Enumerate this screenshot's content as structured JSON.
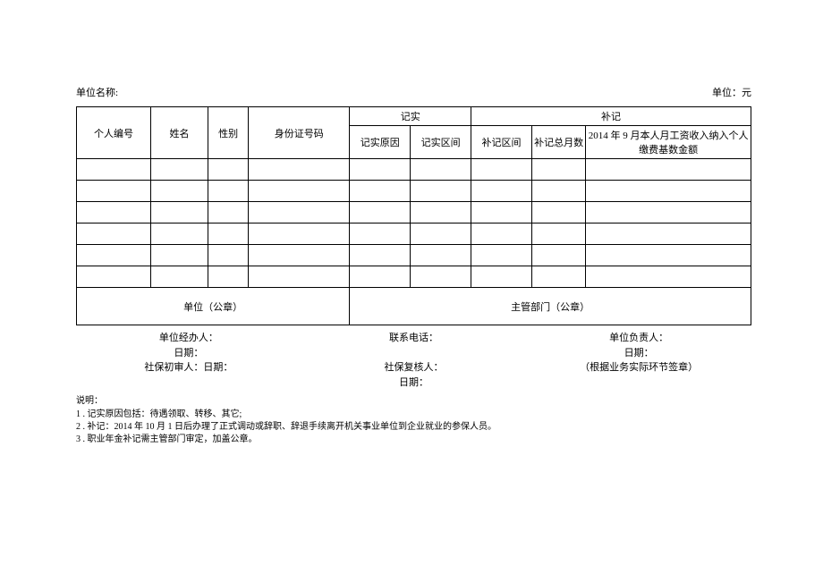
{
  "header": {
    "org_label": "单位名称:",
    "unit_label": "单位：元"
  },
  "table": {
    "cols": {
      "id": "个人编号",
      "name": "姓名",
      "gender": "性别",
      "idnum": "身份证号码",
      "record_group": "记实",
      "record_reason": "记实原因",
      "record_period": "记实区间",
      "supp_group": "补记",
      "supp_period": "补记区间",
      "supp_months": "补记总月数",
      "supp_income": "2014 年 9 月本人月工资收入纳入个人缴费基数金额"
    },
    "seal_org": "单位（公章）",
    "seal_dept": "主管部门（公章）"
  },
  "sig": {
    "org_handler": "单位经办人：",
    "date": "日期：",
    "ss_first": "社保初审人：日期：",
    "contact": "联系电话：",
    "ss_review": "社保复核人：",
    "ss_date": "日期：",
    "org_lead": "单位负责人：",
    "note": "（根据业务实际环节签章）"
  },
  "notes": {
    "title": "说明：",
    "n1": "1 . 记实原因包括：待遇领取、转移、其它;",
    "n2": "2 . 补记：2014 年 10 月 1 日后办理了正式调动或辞职、辞退手续离开机关事业单位到企业就业的参保人员。",
    "n3": "3 . 职业年金补记需主管部门审定，加盖公章。"
  }
}
